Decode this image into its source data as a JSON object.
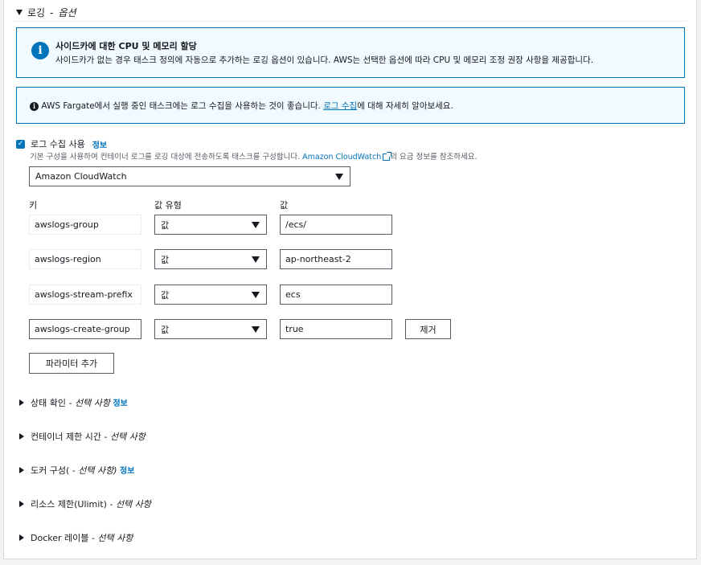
{
  "section": {
    "title": "로깅",
    "optional": "옵션",
    "separator": "-"
  },
  "sidecar_info": {
    "title": "사이드카에 대한 CPU 및 메모리 할당",
    "body": "사이드카가 없는 경우 태스크 정의에 자동으로 추가하는 로깅 옵션이 있습니다. AWS는 선택한 옵션에 따라 CPU 및 메모리 조정 권장 사항을 제공합니다."
  },
  "fargate_info": {
    "text_before": "AWS Fargate에서 실행 중인 태스크에는 로그 수집을 사용하는 것이 좋습니다. ",
    "link": "로그 수집",
    "text_after": "에 대해 자세히 알아보세요."
  },
  "log_collection": {
    "checked": true,
    "label": "로그 수집 사용",
    "info_link": "정보",
    "desc_before": "기본 구성을 사용하여 컨테이너 로그를 로깅 대상에 전송하도록 태스크를 구성합니다. ",
    "desc_link": "Amazon CloudWatch",
    "desc_after": "의 요금 정보를 참조하세요.",
    "destination": "Amazon CloudWatch"
  },
  "params": {
    "col_key": "키",
    "col_type": "값 유형",
    "col_value": "값",
    "rows": [
      {
        "key": "awslogs-group",
        "type": "값",
        "value": "/ecs/"
      },
      {
        "key": "awslogs-region",
        "type": "값",
        "value": "ap-northeast-2"
      },
      {
        "key": "awslogs-stream-prefix",
        "type": "값",
        "value": "ecs"
      },
      {
        "key": "awslogs-create-group",
        "type": "값",
        "value": "true"
      }
    ],
    "remove_label": "제거",
    "add_label": "파라미터 추가"
  },
  "expanders": [
    {
      "title": "상태 확인",
      "sep": "-",
      "optional": "선택 사항",
      "info": "정보"
    },
    {
      "title": "컨테이너 제한 시간",
      "sep": "-",
      "optional": "선택 사항",
      "info": ""
    },
    {
      "title": "도커 구성(",
      "sep": "-",
      "optional": "선택 사항)",
      "info": "정보"
    },
    {
      "title": "리소스 제한(Ulimit)",
      "sep": "-",
      "optional": "선택 사항",
      "info": ""
    },
    {
      "title": "Docker 레이블",
      "sep": "-",
      "optional": "선택 사항",
      "info": ""
    }
  ],
  "colors": {
    "accent": "#0073bb",
    "info_bg": "#f1faff",
    "border": "#545b64",
    "page_bg": "#f2f3f3"
  },
  "icons": [
    "triangle-down-icon",
    "info-icon",
    "checkbox-checked-icon",
    "external-link-icon",
    "caret-down-icon",
    "triangle-right-icon"
  ]
}
